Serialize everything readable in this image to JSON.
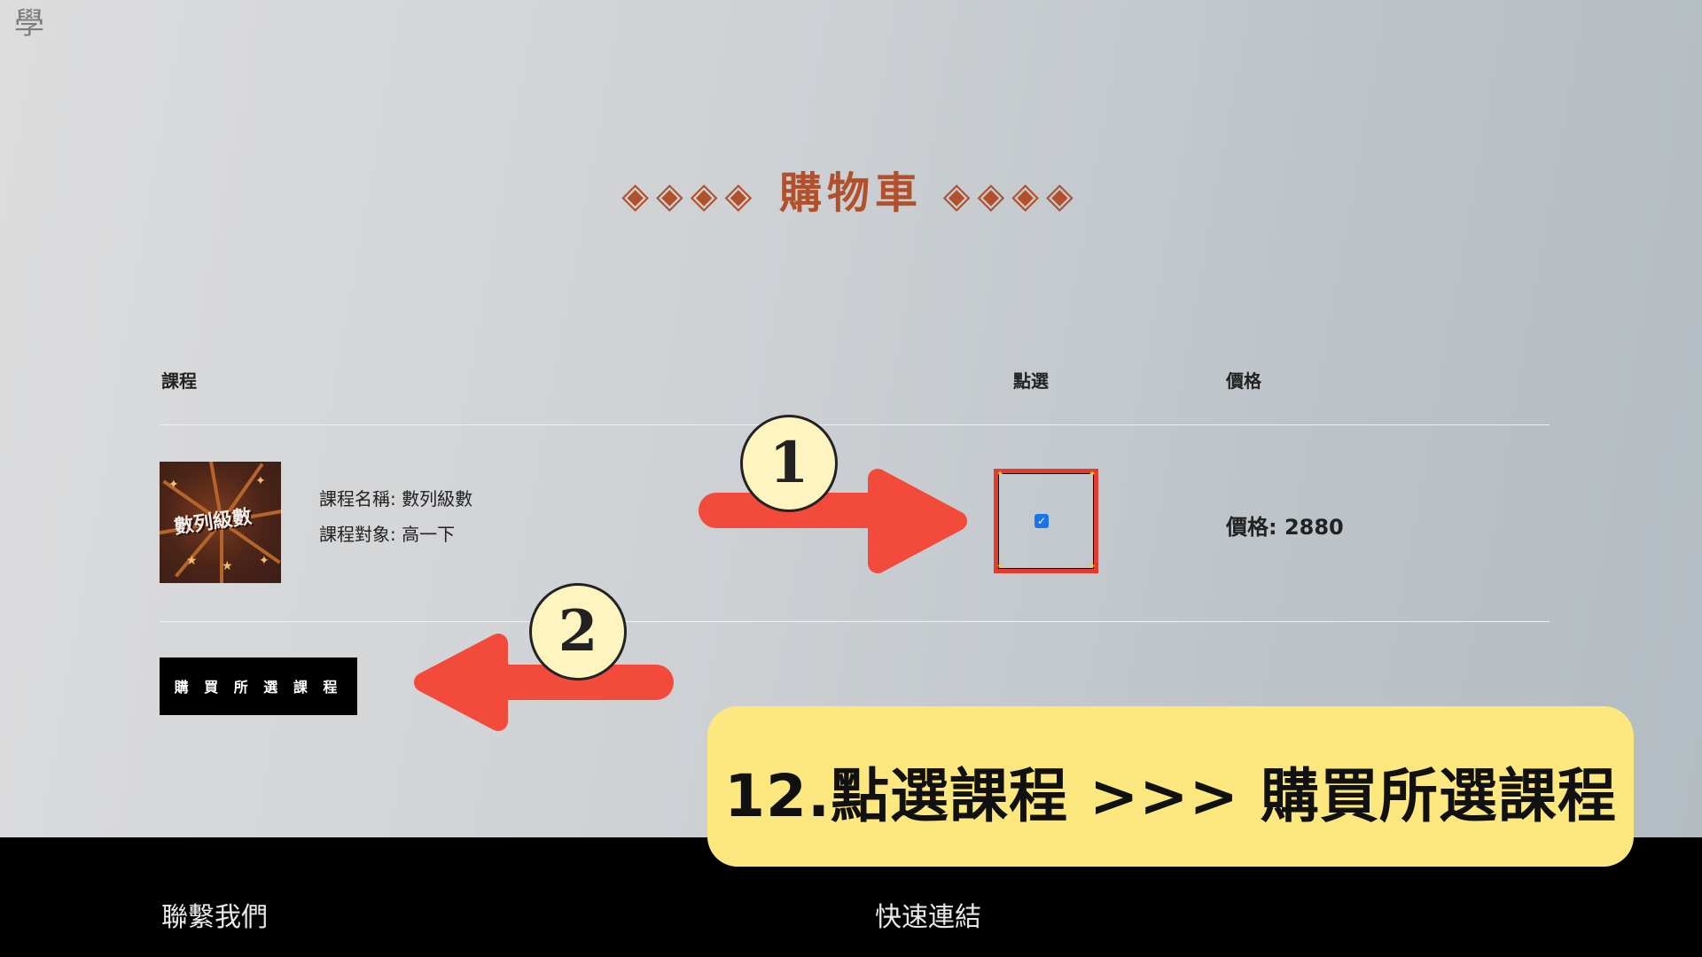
{
  "logo": {
    "glyph": "學",
    "icon": "logo-icon"
  },
  "page_title": {
    "text": "購物車",
    "decor_left": "◈◈◈◈",
    "decor_right": "◈◈◈◈"
  },
  "table": {
    "headers": {
      "course": "課程",
      "select": "點選",
      "price": "價格"
    },
    "rows": [
      {
        "thumbnail_text": "數列級數",
        "course_name": "課程名稱: 數列級數",
        "course_target": "課程對象: 高一下",
        "checked": true,
        "price": "價格: 2880"
      }
    ]
  },
  "buy_button": {
    "label": "購 買 所 選 課 程"
  },
  "annotations": {
    "step1": "1",
    "step2": "2",
    "callout": "12.點選課程  >>> 購買所選課程",
    "arrow_color": "#f24a3b",
    "highlight_color": "#e43b2f",
    "callout_bg": "#fde77f"
  },
  "footer": {
    "contact": "聯繫我們",
    "quick_links": "快速連結"
  },
  "colors": {
    "title": "#b0512c",
    "checkbox": "#1a73e8",
    "footer_bg": "#000000"
  }
}
